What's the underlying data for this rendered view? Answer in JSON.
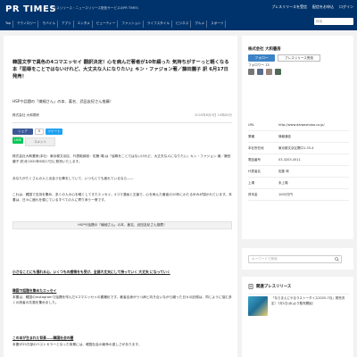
{
  "header": {
    "logo": "PR TIMES",
    "tagline": "プレスリリース・ニュースリリース配信サービスのPR TIMES",
    "links": [
      "プレスリリースを受信",
      "配信をお申込",
      "ログイン"
    ],
    "search_placeholder": "検索",
    "categories": [
      "Top",
      "テクノロジー",
      "モバイル",
      "アプリ",
      "エンタメ",
      "ビューティー",
      "ファッション",
      "ライフスタイル",
      "ビジネス",
      "グルメ",
      "スポーツ"
    ]
  },
  "article": {
    "title": "韓国文学で異色の4コマエッセイ 翻訳決定！心を病んだ著者が10年綴った 気持ちがすーっと軽くなる本『屈辱をことではないけれど、大丈夫な人になりたい』キン・ファジョン著／藤田麗子 訳 6月17日発売！",
    "subtitle": "HSPや話題の「繊細さん」の本、著名、武田友紀さん推薦！",
    "company": "株式会社 大和書房",
    "date": "2020年6月5日 10時00分",
    "share": {
      "facebook": "シェア",
      "twitter": "ツイート",
      "line": "LINE",
      "counts": [
        "0",
        "0"
      ],
      "fb_comment": "コメント"
    },
    "paragraphs": [
      "株式会社大和書房(本社：東京都文京区、代表取締役：佐藤 靖)は『屈辱をことではないけれど、大丈夫な人になりたい』キン・ファジョン 著／藤田麗子 訳)を2020年6月17日に発売いたします。",
      "あなたがたくさんの人と出会う仕事をしていて、いつもとても疲れているなら——",
      "これは、韓国で支持を集め、多くの人の心を軽くしてきたエッセイ。4コマ漫画と文章で、心を病んだ著者の10年にわたる歩みが描かれています。本書は、日々に疲れを感じているすべての人に寄り添う一冊です。"
    ],
    "caption": "HSPや話題の「繊細さん」の本、著名、武田友紀さん推薦！",
    "lines": [
      "小さなことにも揺れる心、いくつもの感情をも受け、全部大丈夫にして持っていく 大丈夫 になっていく",
      "韓国で話題を集めたエッセイ",
      "この本が生まれた背景——韓国社会の闇"
    ],
    "paragraph4": "本書は、韓国のInstagramで話題を呼んだ4コマエッセイの書籍化です。著者自身がうつ病と向き合いながら綴った日々の記録は、同じように悩む多くの読者の共感を集めました。",
    "paragraph5": "本書が25万部のベストセラーとなった背景には、韓国社会の競争の激しさがあります。"
  },
  "sidebar": {
    "company_name": "株式会社 大和書房",
    "follow_label": "フォロー",
    "press_label": "プレスリリース受信",
    "followers_label": "フォロワー 13",
    "info": [
      {
        "k": "URL",
        "v": "http://www.daiwashobo.co.jp/"
      },
      {
        "k": "業種",
        "v": "情報通信"
      },
      {
        "k": "本社所在地",
        "v": "東京都文京区関口1-33-4"
      },
      {
        "k": "電話番号",
        "v": "03-3203-4511"
      },
      {
        "k": "代表者名",
        "v": "佐藤 靖"
      },
      {
        "k": "上場",
        "v": "未上場"
      },
      {
        "k": "資本金",
        "v": "1000万円"
      }
    ],
    "search_placeholder": "キーワードで検索",
    "related_title": "関連プレスリリース",
    "related_text": "「ならまえにやるラストーダイス2020-7月」発売決定！7月1日(水)より販売開始！"
  }
}
